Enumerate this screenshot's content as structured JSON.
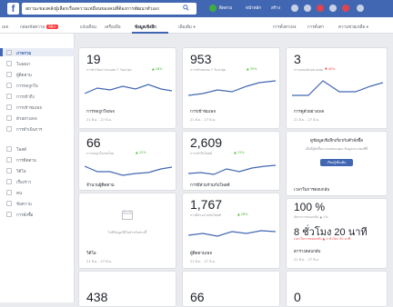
{
  "topbar": {
    "logo": "f",
    "search_value": "สถานะของคลังผู้เลือกเรื่องความเหมือนของคนที่ต้องการพัฒนาตัวเอง",
    "items": [
      "ติดตาม",
      "หน้าหลัก",
      "สร้าง"
    ]
  },
  "tabs": {
    "items": [
      "เพจ",
      "กล่องข้อความ",
      "แจ้งเตือน",
      "เครื่องมือ",
      "ข้อมูลเชิงลึก",
      "เพิ่มเติม ▾"
    ],
    "badge": "99+",
    "right_items": [
      "การตั้งค่าเพจ",
      "การตั้งค่า",
      "ความช่วยเหลือ ▾"
    ]
  },
  "sidebar": {
    "items": [
      "ภาพรวม",
      "โฆษณา",
      "ผู้ติดตาม",
      "การกดถูกใจ",
      "การเข้าถึง",
      "การเข้าชมเพจ",
      "ตัวอย่างเพจ",
      "การดำเนินการ",
      "โพสต์",
      "การติดตาม",
      "วิดีโอ",
      "เรื่องราว",
      "คน",
      "ข้อความ",
      "การสั่งซื้อ"
    ]
  },
  "cards": [
    {
      "value": "19",
      "sub": "การดำเนินการบนเพจ 7 วันล่าสุด",
      "pct": "▲ 18%",
      "trend": "up",
      "title": "การกดถูกใจเพจ",
      "date": "21 มิ.ย. - 27 มิ.ย."
    },
    {
      "value": "953",
      "sub": "การเข้าชมเพจ 7 วันล่าสุด",
      "pct": "▲ 35%",
      "trend": "up",
      "title": "การเข้าชมเพจ",
      "date": "21 มิ.ย. - 27 มิ.ย."
    },
    {
      "value": "3",
      "sub": "การแสดงตัวอย่างเพจ",
      "pct": "▼ 40%",
      "trend": "down",
      "title": "การดูตัวอย่างเพจ",
      "date": "21 มิ.ย. - 27 มิ.ย."
    },
    {
      "value": "66",
      "sub": "การกดถูกใจเพจใหม่",
      "pct": "▲ 22%",
      "trend": "up",
      "title": "การกดถูกใจเพจ",
      "date": "21 มิ.ย. - 27 มิ.ย."
    },
    {
      "value": "2,609",
      "sub": "การเข้าถึงโพสต์",
      "pct": "▲ 15%",
      "trend": "up",
      "title": "การเข้าถึงโพสต์",
      "date": "21 มิ.ย. - 27 มิ.ย."
    },
    {
      "value": "1,767",
      "sub": "การมีส่วนร่วมกับโพสต์",
      "pct": "▲ 28%",
      "trend": "up",
      "title": "ผู้ติดตามเพจ",
      "date": "21 มิ.ย. - 27 มิ.ย."
    },
    {
      "value": "438",
      "sub": "",
      "pct": "",
      "trend": "up",
      "title": "",
      "date": ""
    },
    {
      "value": "66",
      "sub": "",
      "pct": "",
      "trend": "up",
      "title": "",
      "date": ""
    }
  ],
  "titles_row2": [
    "จำนวนผู้ติดตาม",
    "การมีส่วนร่วมกับโพสต์",
    "เวลาในการตอบกลับ"
  ],
  "promo": {
    "title": "ดูข้อมูลเชิงลึกเกี่ยวกับคำสั่งซื้อ",
    "text": "เมื่อมีผู้สั่งซื้อจากเพจของคุณ ข้อมูลจะแสดงที่นี่",
    "button": "เรียนรู้เพิ่มเติม"
  },
  "response": {
    "rate": "100 %",
    "rate_sub": "อัตราการตอบกลับ ▲ 1%",
    "time": "8 ชั่วโมง 20 นาที",
    "time_sub": "เวลาในการตอบกลับ ▲ 1 ชั่วโมง 30 นาที",
    "title": "ตารางตอบกลับ",
    "date": "21 มิ.ย. - 27 มิ.ย."
  },
  "empty": {
    "text": "ไม่มีข้อมูลวิดีโอสำหรับช่วงนี้",
    "title": "วิดีโอ",
    "date": "21 มิ.ย. - 27 มิ.ย."
  },
  "bottom_right_value": "0",
  "colors": {
    "brand": "#4267b2",
    "up": "#42b72a",
    "down": "#fa3e3e",
    "spark": "#4267b2"
  }
}
